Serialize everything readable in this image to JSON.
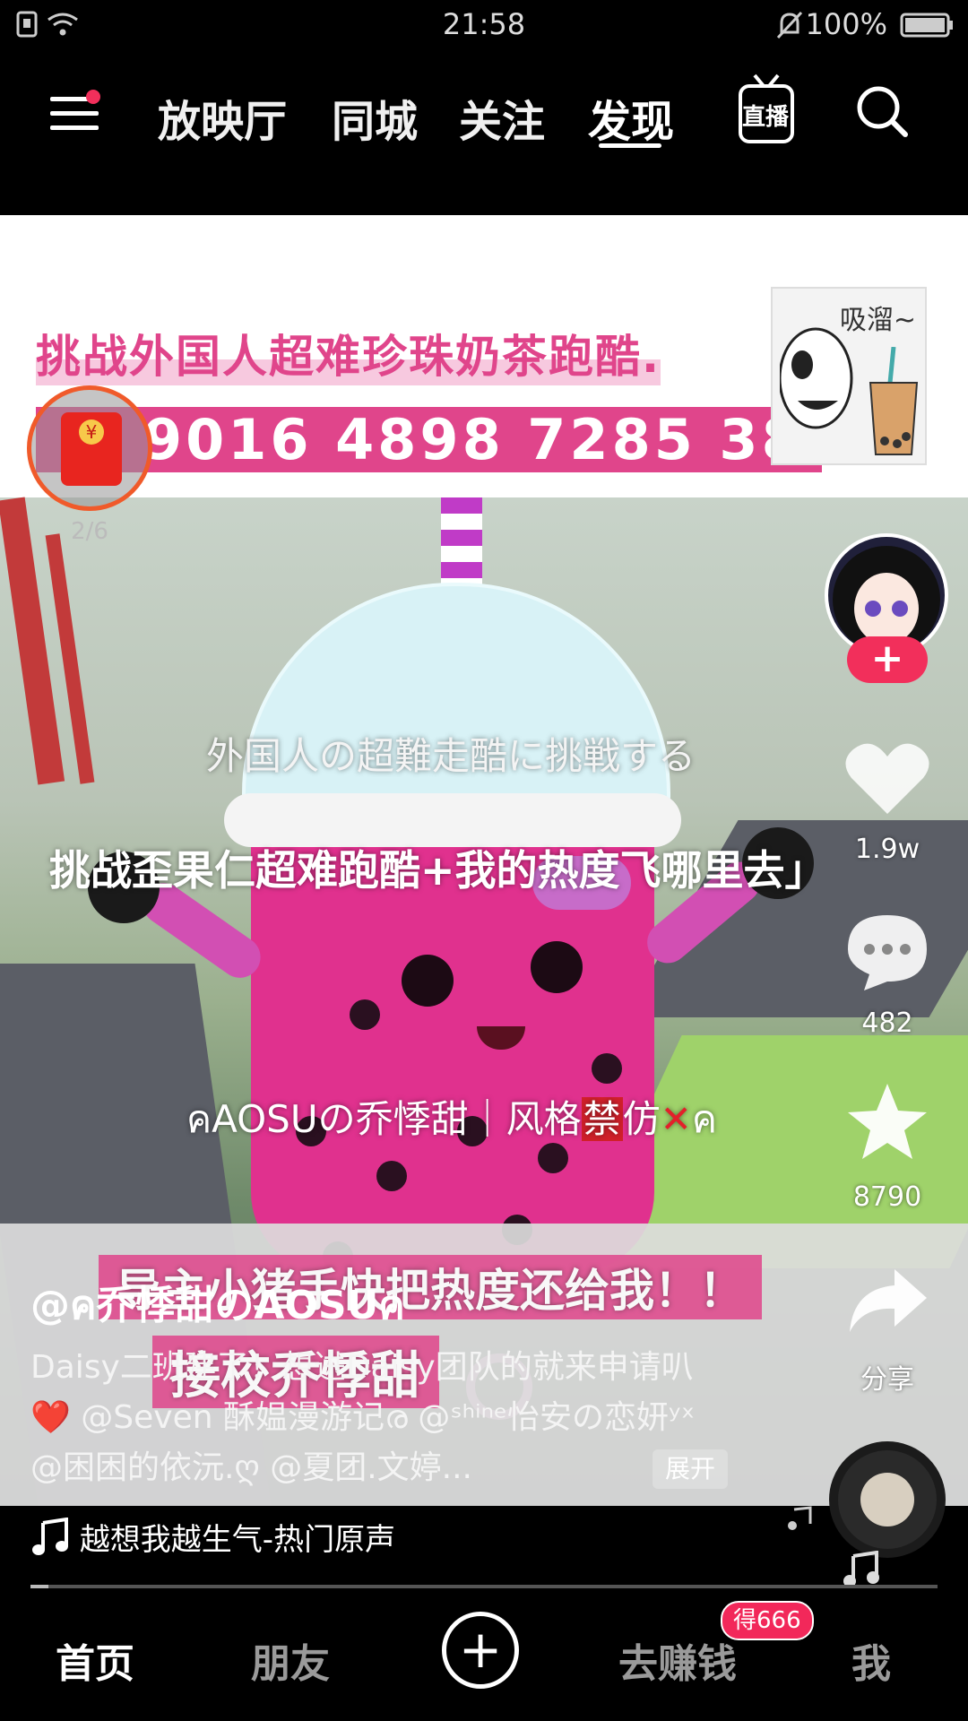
{
  "status_bar": {
    "time": "21:58",
    "battery": "100%"
  },
  "top_nav": {
    "tabs": [
      {
        "label": "放映厅"
      },
      {
        "label": "同城"
      },
      {
        "label": "关注"
      },
      {
        "label": "发现",
        "active": true
      }
    ],
    "live_label": "直播"
  },
  "video": {
    "banner_title": "挑战外国人超难珍珠奶茶跑酷.",
    "banner_id": "9016 4898 7285 38",
    "sticker_text": "吸溜~",
    "caption_jp": "外国人の超難走酷に挑戦する",
    "caption_cn": "挑战歪果仁超难跑酷+我的热度飞哪里去」",
    "watermark_prefix": "ค",
    "watermark": "AOSUの乔悸甜｜风格",
    "watermark_forbid": "禁",
    "watermark_tail": "仿",
    "watermark_x": "✕",
    "watermark_end": "ค",
    "bottom_banner_1": "导主小猪手快把热度还给我！！",
    "bottom_banner_2": "接校乔悸甜"
  },
  "red_packet": {
    "progress": "2/6",
    "symbol": "¥"
  },
  "right_rail": {
    "follow_symbol": "+",
    "likes": "1.9w",
    "comments": "482",
    "favorites": "8790",
    "share_label": "分享"
  },
  "caption": {
    "username": "@ค乔悸甜のAOSUค",
    "description": "Daisy二班建了！想进Daisy团队的就来申请叭❤️ @Seven 酥媪漫游记ര @ˢʰⁱⁿᵉ怡安の恋妍ʸˣ @困困的依沅.ღ @夏团.文婷...",
    "expand_label": "展开",
    "music": "越想我越生气-热门原声",
    "playback_progress": 0.02
  },
  "bottom_nav": {
    "home": "首页",
    "friends": "朋友",
    "add_symbol": "+",
    "earn": "去赚钱",
    "earn_badge": "得666",
    "me": "我"
  },
  "colors": {
    "accent": "#f22f5b",
    "red_packet_ring": "#f05a2a",
    "banner_pink": "#e0458b"
  }
}
